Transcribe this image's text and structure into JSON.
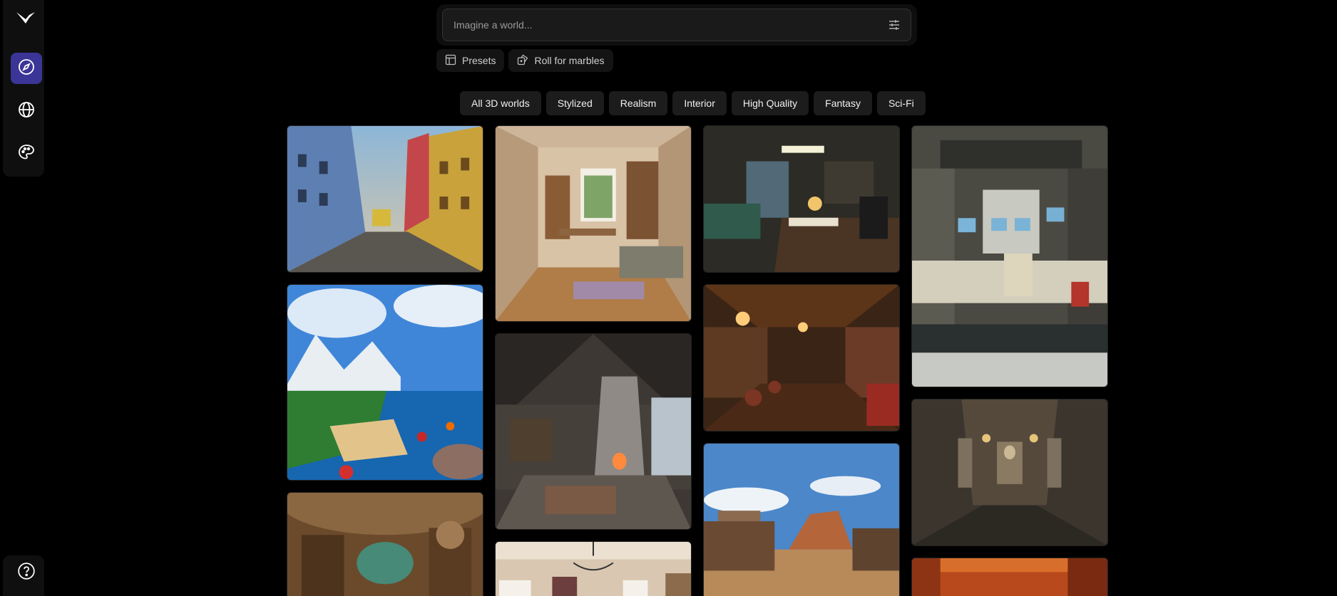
{
  "sidebar": {
    "logo": "marble-logo-icon",
    "nav": [
      {
        "name": "explore",
        "icon": "compass-icon",
        "active": true
      },
      {
        "name": "worlds",
        "icon": "globe-icon",
        "active": false
      },
      {
        "name": "styles",
        "icon": "palette-icon",
        "active": false
      }
    ],
    "help_icon": "help-circle-icon"
  },
  "search": {
    "placeholder": "Imagine a world...",
    "value": ""
  },
  "actions": {
    "presets_label": "Presets",
    "roll_label": "Roll for marbles"
  },
  "filters": [
    "All 3D worlds",
    "Stylized",
    "Realism",
    "Interior",
    "High Quality",
    "Fantasy",
    "Sci-Fi"
  ],
  "colors": {
    "background": "#000000",
    "accent": "#3a3596",
    "chip": "#1c1c1c"
  },
  "gallery": [
    "lisbon-street-tram",
    "cartoon-island-coast",
    "cave-library",
    "bedroom-study",
    "rustic-cabin-fireplace",
    "bright-room-chandelier",
    "dark-office-aquarium",
    "wooden-tavern-bar",
    "western-town-desert",
    "retro-spaceship-console",
    "stone-gallery-statues",
    "warm-orange-hall"
  ]
}
